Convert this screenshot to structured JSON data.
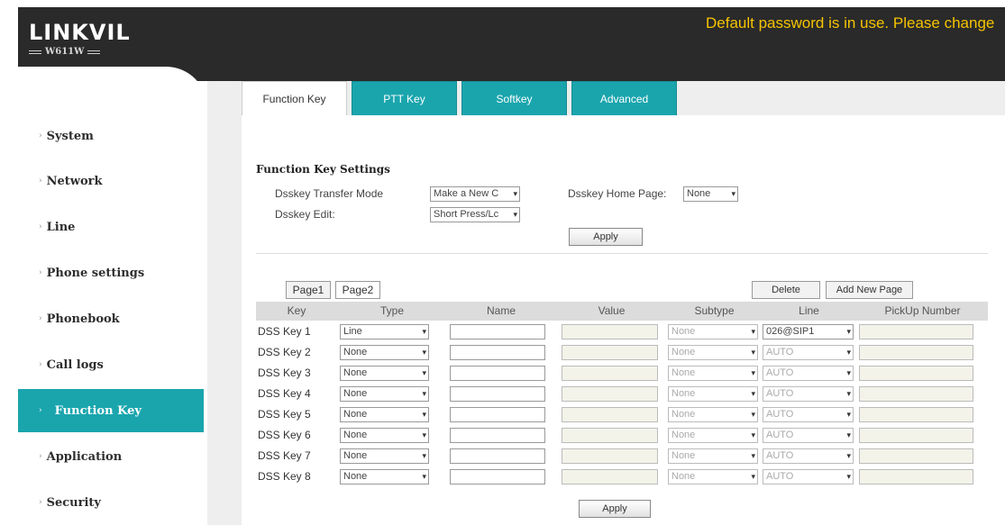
{
  "header": {
    "logo_main": "LINKVIL",
    "logo_model": "W611W",
    "warning": "Default password is in use. Please change"
  },
  "sidebar": {
    "items": [
      {
        "label": "System"
      },
      {
        "label": "Network"
      },
      {
        "label": "Line"
      },
      {
        "label": "Phone settings"
      },
      {
        "label": "Phonebook"
      },
      {
        "label": "Call logs"
      },
      {
        "label": "Function Key"
      },
      {
        "label": "Application"
      },
      {
        "label": "Security"
      }
    ],
    "active": "Function Key"
  },
  "tabs": [
    {
      "label": "Function Key"
    },
    {
      "label": "PTT Key"
    },
    {
      "label": "Softkey"
    },
    {
      "label": "Advanced"
    }
  ],
  "settings": {
    "title": "Function Key Settings",
    "transfer_mode_label": "Dsskey Transfer Mode",
    "transfer_mode_value": "Make a New C",
    "home_page_label": "Dsskey Home Page:",
    "home_page_value": "None",
    "edit_label": "Dsskey Edit:",
    "edit_value": "Short Press/Lc",
    "apply": "Apply"
  },
  "pages": {
    "page1": "Page1",
    "page2": "Page2",
    "delete": "Delete",
    "add_new_page": "Add New Page"
  },
  "table": {
    "headers": [
      "Key",
      "Type",
      "Name",
      "Value",
      "Subtype",
      "Line",
      "PickUp Number"
    ],
    "rows": [
      {
        "key": "DSS Key 1",
        "type": "Line",
        "subtype": "None",
        "line": "026@SIP1"
      },
      {
        "key": "DSS Key 2",
        "type": "None",
        "subtype": "None",
        "line": "AUTO"
      },
      {
        "key": "DSS Key 3",
        "type": "None",
        "subtype": "None",
        "line": "AUTO"
      },
      {
        "key": "DSS Key 4",
        "type": "None",
        "subtype": "None",
        "line": "AUTO"
      },
      {
        "key": "DSS Key 5",
        "type": "None",
        "subtype": "None",
        "line": "AUTO"
      },
      {
        "key": "DSS Key 6",
        "type": "None",
        "subtype": "None",
        "line": "AUTO"
      },
      {
        "key": "DSS Key 7",
        "type": "None",
        "subtype": "None",
        "line": "AUTO"
      },
      {
        "key": "DSS Key 8",
        "type": "None",
        "subtype": "None",
        "line": "AUTO"
      }
    ],
    "apply": "Apply"
  },
  "colors": {
    "accent": "#1aa5ad",
    "header_bg": "#2a2a2a",
    "warning": "#f5c400",
    "content_bg": "#eeeeee"
  }
}
